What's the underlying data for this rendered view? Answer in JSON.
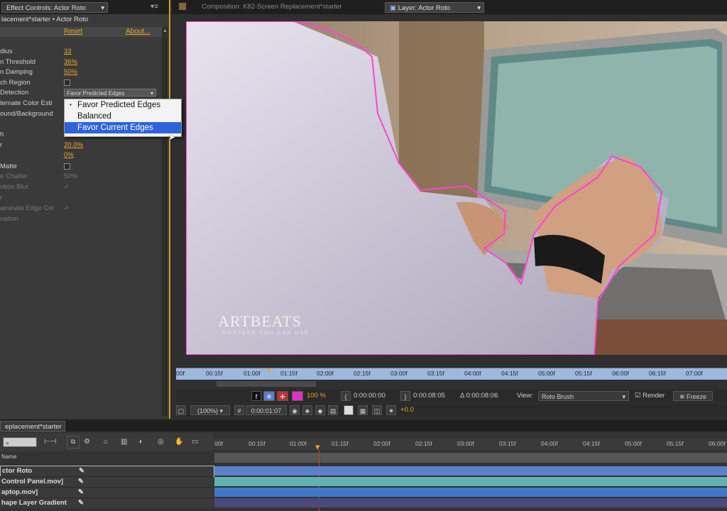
{
  "effect_panel": {
    "tab_label": "Effect Controls: Actor Roto",
    "breadcrumb": "lacement*starter • Actor Roto",
    "reset_label": "Reset",
    "about_label": "About...",
    "rows": [
      {
        "label": "dius",
        "value": "33"
      },
      {
        "label": "n Threshold",
        "value": "36%"
      },
      {
        "label": "n Damping",
        "value": "50%"
      },
      {
        "label": "ch Region",
        "value": ""
      },
      {
        "label": "Detection",
        "value": "Favor Predicted Edges"
      },
      {
        "label": "ternate Color Esti",
        "value": ""
      },
      {
        "label": "ound/Background",
        "value": ""
      },
      {
        "label": "h",
        "value": ""
      },
      {
        "label": "r",
        "value": "20.0%"
      },
      {
        "label": "",
        "value": "0%"
      },
      {
        "label": "Matte",
        "value": ""
      },
      {
        "label": "e Chatter",
        "value": "50%"
      },
      {
        "label": "otion Blur",
        "value": "✓"
      },
      {
        "label": "r",
        "value": ""
      },
      {
        "label": "aminate Edge Col",
        "value": "✓"
      },
      {
        "label": "nation",
        "value": ""
      }
    ],
    "menu_options": [
      "Favor Predicted Edges",
      "Balanced",
      "Favor Current Edges"
    ]
  },
  "viewer": {
    "comp_tab": "Composition: K82-Screen Replacement*starter",
    "layer_tab": "Layer: Actor Roto",
    "watermark_title": "ARTBEATS",
    "watermark_sub": "FOOTAGE YOU CAN USE",
    "ruler_labels": [
      "00f",
      "00:15f",
      "01:00f",
      "01:15f",
      "02:00f",
      "02:15f",
      "03:00f",
      "03:15f",
      "04:00f",
      "04:15f",
      "05:00f",
      "05:15f",
      "06:00f",
      "06:15f",
      "07:00f"
    ],
    "zoom_pct": "100 %",
    "in_time": "0:00:00:00",
    "out_time": "0:00:08:05",
    "duration": "Δ 0:00:08:06",
    "view_label": "View:",
    "view_value": "Roto Brush",
    "render_label": "Render",
    "freeze_label": "Freeze",
    "magnification": "(100%)",
    "current_time": "0:00:01:07",
    "exposure": "+0.0"
  },
  "timeline": {
    "tab_label": "eplacement*starter",
    "ruler_labels": [
      "00f",
      "00:15f",
      "01:00f",
      "01:15f",
      "02:00f",
      "02:15f",
      "03:00f",
      "03:15f",
      "04:00f",
      "04:15f",
      "05:00f",
      "05:15f",
      "06:00f"
    ],
    "col_name": "Name",
    "layers": [
      {
        "name": "ctor Roto",
        "color": "#5b7fc9"
      },
      {
        "name": "Control Panel.mov]",
        "color": "#5fb3b0"
      },
      {
        "name": "aptop.mov]",
        "color": "#3f78c9"
      },
      {
        "name": "hape Layer Gradient",
        "color": "#4a4a7a"
      }
    ]
  },
  "colors": {
    "accent": "#e8a72c",
    "matte_outline": "#ff44d0",
    "menu_highlight": "#2e63d9"
  }
}
